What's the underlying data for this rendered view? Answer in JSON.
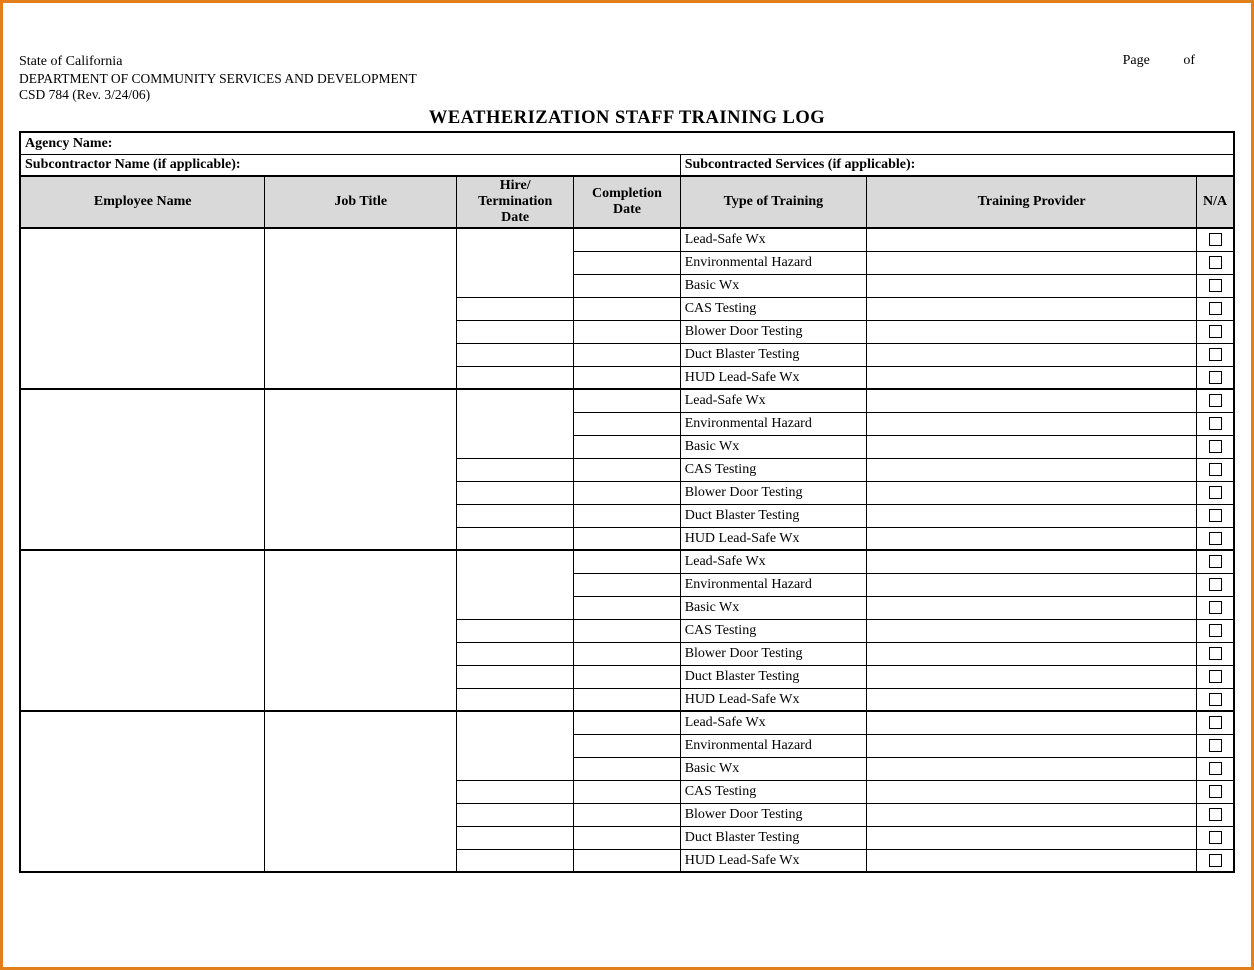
{
  "meta": {
    "state": "State of California",
    "department": "DEPARTMENT OF COMMUNITY SERVICES AND DEVELOPMENT",
    "form_rev": "CSD 784 (Rev. 3/24/06)",
    "title": "WEATHERIZATION STAFF TRAINING LOG",
    "page_label": "Page",
    "of_label": "of"
  },
  "labels": {
    "agency_name": "Agency Name:",
    "subcontractor_name": "Subcontractor Name (if applicable):",
    "subcontracted_services": "Subcontracted Services (if applicable):"
  },
  "columns": {
    "employee_name": "Employee Name",
    "job_title": "Job Title",
    "hire_termination_date": "Hire/ Termination Date",
    "completion_date": "Completion Date",
    "type_of_training": "Type of Training",
    "training_provider": "Training Provider",
    "na": "N/A"
  },
  "training_types": [
    "Lead-Safe Wx",
    "Environmental Hazard",
    "Basic Wx",
    "CAS Testing",
    "Blower Door Testing",
    "Duct Blaster Testing",
    "HUD Lead-Safe Wx"
  ],
  "employee_blocks": 4
}
